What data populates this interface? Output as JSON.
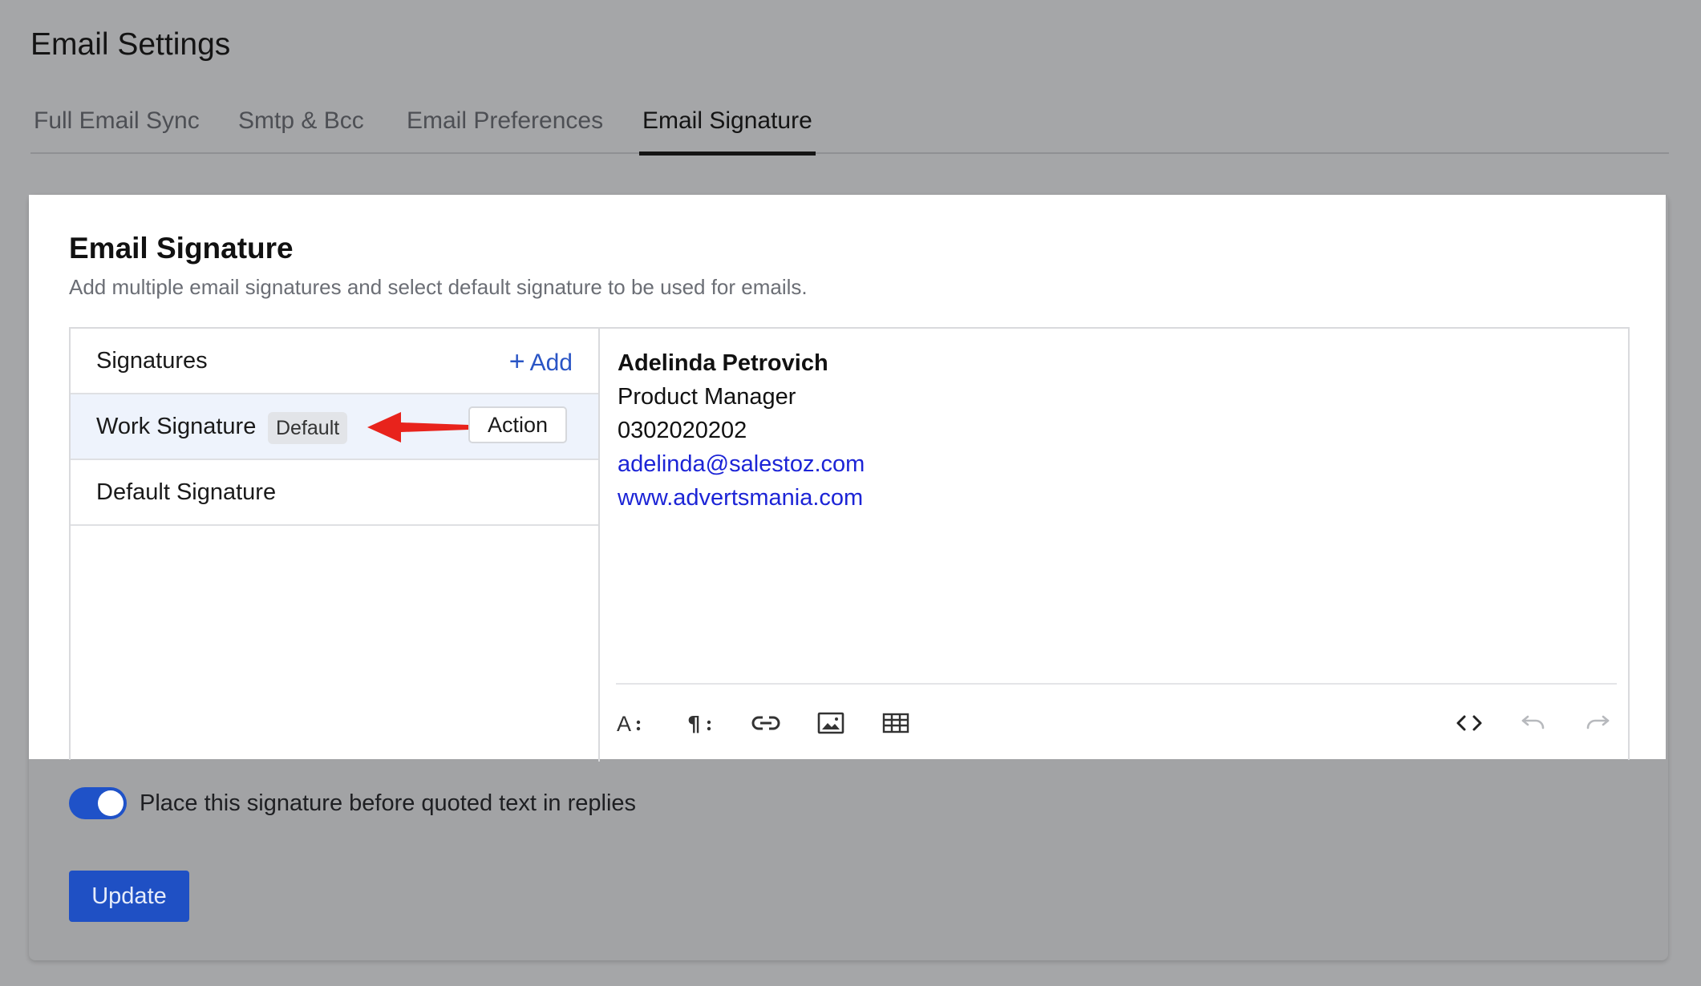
{
  "page": {
    "title": "Email Settings"
  },
  "tabs": [
    {
      "label": "Full Email Sync",
      "active": false
    },
    {
      "label": "Smtp & Bcc",
      "active": false
    },
    {
      "label": "Email Preferences",
      "active": false
    },
    {
      "label": "Email Signature",
      "active": true
    }
  ],
  "section": {
    "title": "Email Signature",
    "description": "Add multiple email signatures and select default signature to be used for emails."
  },
  "signatures": {
    "header_label": "Signatures",
    "add_label": "Add",
    "add_icon": "plus-icon",
    "items": [
      {
        "name": "Work Signature",
        "badge": "Default",
        "action_label": "Action",
        "selected": true
      },
      {
        "name": "Default Signature",
        "selected": false
      }
    ]
  },
  "editor": {
    "name": "Adelinda Petrovich",
    "job_title": "Product Manager",
    "phone": "0302020202",
    "email": "adelinda@salestoz.com",
    "website": "www.advertsmania.com",
    "link_color": "#1c24d6",
    "toolbar_icons": [
      "font-size-icon",
      "paragraph-icon",
      "link-icon",
      "image-icon",
      "table-icon",
      "code-view-icon",
      "undo-icon",
      "redo-icon"
    ]
  },
  "options": {
    "place_before_quoted_label": "Place this signature before quoted text in replies",
    "place_before_quoted_enabled": true
  },
  "actions": {
    "update_label": "Update"
  },
  "colors": {
    "accent": "#1f52c8",
    "annotation_arrow": "#e8231c",
    "overlay": "#a5a6a8"
  }
}
